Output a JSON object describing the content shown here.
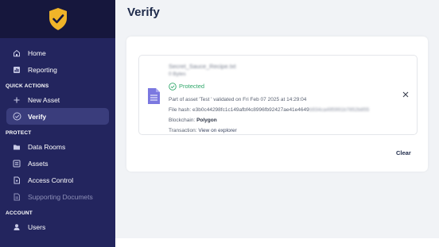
{
  "sidebar": {
    "items_top": [
      {
        "label": "Home",
        "icon": "home-icon"
      },
      {
        "label": "Reporting",
        "icon": "reporting-icon"
      }
    ],
    "quick_actions": {
      "title": "QUICK ACTIONS",
      "items": [
        {
          "label": "New Asset",
          "icon": "plus-icon"
        },
        {
          "label": "Verify",
          "icon": "check-circle-icon",
          "active": true
        }
      ]
    },
    "protect": {
      "title": "PROTECT",
      "items": [
        {
          "label": "Data Rooms",
          "icon": "folder-icon"
        },
        {
          "label": "Assets",
          "icon": "list-icon"
        },
        {
          "label": "Access Control",
          "icon": "lock-icon"
        },
        {
          "label": "Supporting Documets",
          "icon": "document-icon",
          "disabled": true
        }
      ]
    },
    "account": {
      "title": "ACCOUNT",
      "items": [
        {
          "label": "Users",
          "icon": "user-icon"
        }
      ]
    }
  },
  "main": {
    "title": "Verify",
    "file": {
      "name": "Secret_Sauce_Recipe.txt",
      "size": "0 Bytes",
      "status": "Protected",
      "asset_line": "Part of asset 'Test ' validated on Fri Feb 07 2025 at 14:29:04",
      "hash_label": "File hash:",
      "hash_visible": "e3b0c44298fc1c149afbf4c8996fb92427ae41e4649",
      "hash_blurred": "b934ca495991b7852b855",
      "blockchain_label": "Blockchain:",
      "blockchain_value": "Polygon",
      "transaction_label": "Transaction:",
      "transaction_link": "View on explorer"
    },
    "clear_label": "Clear"
  },
  "colors": {
    "sidebar_bg": "#23255e",
    "logo_bg": "#16173d",
    "shield": "#f0b429",
    "protected": "#2fa76a",
    "file_icon": "#7b78e0"
  }
}
